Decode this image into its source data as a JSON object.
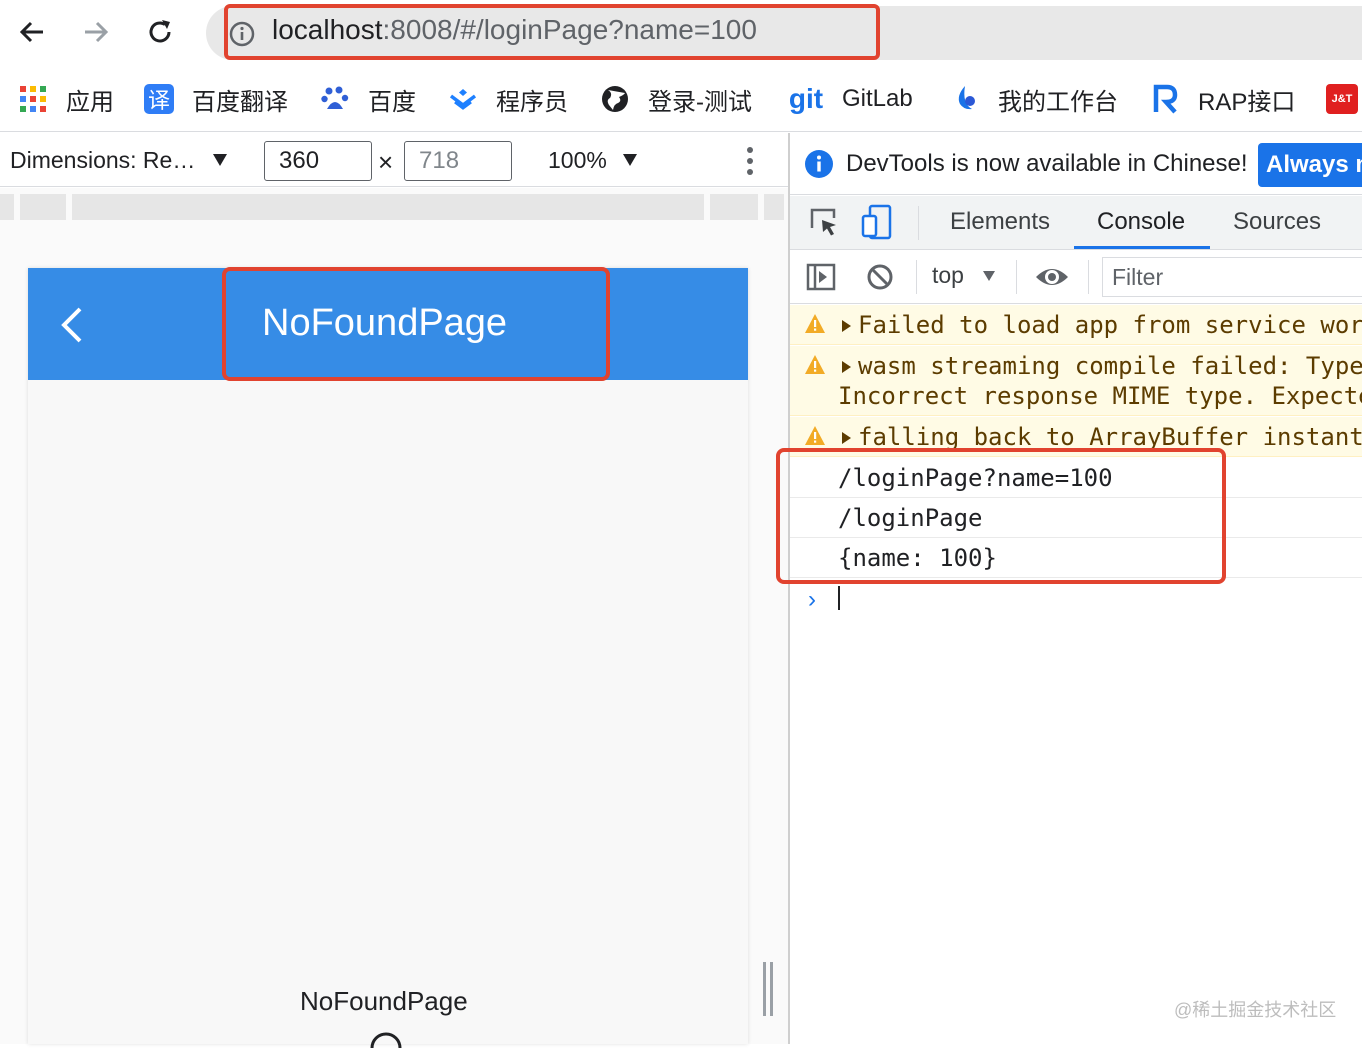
{
  "browser": {
    "url_host": "localhost",
    "url_rest": ":8008/#/loginPage?name=100",
    "bookmarks": [
      {
        "label": "应用",
        "icon": "apps-grid-icon"
      },
      {
        "label": "百度翻译",
        "icon": "baidu-translate-icon"
      },
      {
        "label": "百度",
        "icon": "baidu-paw-icon"
      },
      {
        "label": "程序员",
        "icon": "juejin-icon"
      },
      {
        "label": "登录-测试",
        "icon": "globe-icon"
      },
      {
        "label": "GitLab",
        "icon": "git-icon"
      },
      {
        "label": "我的工作台",
        "icon": "workbench-icon"
      },
      {
        "label": "RAP接口",
        "icon": "rap-icon"
      },
      {
        "label": "",
        "icon": "jt-icon"
      }
    ],
    "git_logo_text": "git",
    "jt_logo_text": "J&T",
    "translate_logo_text": "译"
  },
  "device_toolbar": {
    "dimensions_label": "Dimensions: Re…",
    "width": "360",
    "height": "718",
    "times": "×",
    "zoom": "100%"
  },
  "app": {
    "title": "NoFoundPage",
    "body_text": "NoFoundPage"
  },
  "devtools": {
    "info_text": "DevTools is now available in Chinese!",
    "always_button": "Always match Chrome's language",
    "tabs": [
      "Elements",
      "Console",
      "Sources"
    ],
    "active_tab": "Console",
    "context": "top",
    "filter_placeholder": "Filter",
    "messages": [
      {
        "level": "warning",
        "text": "Failed to load app from service worker"
      },
      {
        "level": "warning",
        "text": "wasm streaming compile failed: TypeError:",
        "text2": "Incorrect response MIME type. Expected"
      },
      {
        "level": "warning",
        "text": "falling back to ArrayBuffer instantiation"
      },
      {
        "level": "log",
        "text": "/loginPage?name=100"
      },
      {
        "level": "log",
        "text": "/loginPage"
      },
      {
        "level": "log",
        "text": "{name: 100}"
      }
    ],
    "prompt": "›"
  },
  "watermark": "@稀土掘金技术社区",
  "colors": {
    "accent": "#368ce6",
    "highlight": "#e1432f",
    "devtools_blue": "#1a73e8",
    "warning_bg": "#fffbe5"
  }
}
